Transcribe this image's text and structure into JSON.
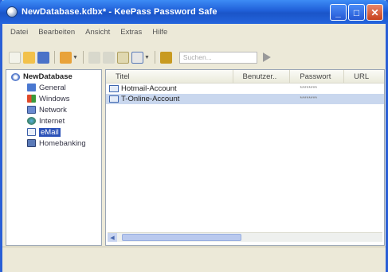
{
  "window": {
    "title": "NewDatabase.kdbx* - KeePass Password Safe",
    "buttons": {
      "minimize": "_",
      "maximize": "□",
      "close": "✕"
    }
  },
  "menu": [
    "Datei",
    "Bearbeiten",
    "Ansicht",
    "Extras",
    "Hilfe"
  ],
  "toolbar": {
    "search_placeholder": "Suchen..."
  },
  "tree": {
    "root": "NewDatabase",
    "groups": [
      {
        "label": "General",
        "icon": "folder-icon"
      },
      {
        "label": "Windows",
        "icon": "windows-icon"
      },
      {
        "label": "Network",
        "icon": "network-icon"
      },
      {
        "label": "Internet",
        "icon": "internet-icon"
      },
      {
        "label": "eMail",
        "icon": "email-icon",
        "selected": true
      },
      {
        "label": "Homebanking",
        "icon": "homebanking-icon"
      }
    ]
  },
  "list": {
    "columns": [
      "Titel",
      "Benutzer..",
      "Passwort",
      "URL"
    ],
    "rows": [
      {
        "title": "Hotmail-Account",
        "user": "",
        "password": "********",
        "url": ""
      },
      {
        "title": "T-Online-Account",
        "user": "",
        "password": "********",
        "url": ""
      }
    ]
  },
  "colors": {
    "titlebar": "#1f5fd8",
    "selection": "#2c52b8"
  }
}
